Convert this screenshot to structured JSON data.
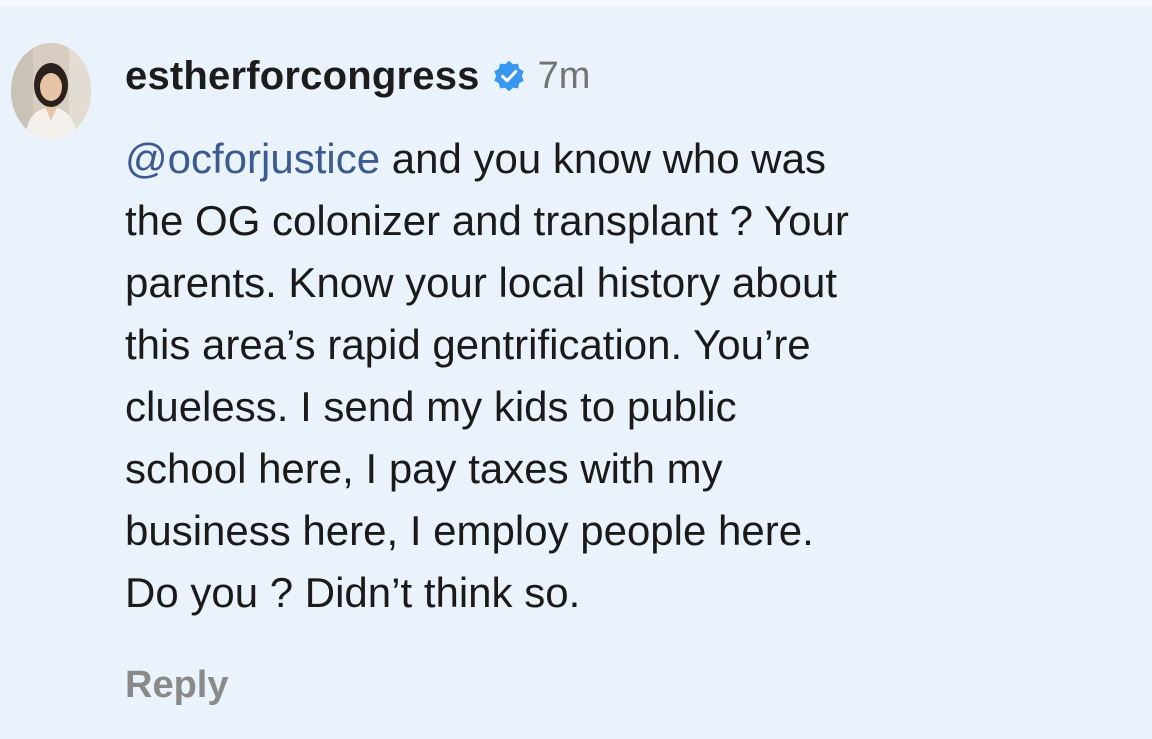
{
  "comment": {
    "username": "estherforcongress",
    "verified": true,
    "timestamp": "7m",
    "mention": "@ocforjustice",
    "lines": [
      " and you know who was",
      "the OG colonizer and transplant ? Your",
      "parents. Know your local history about",
      "this area’s rapid gentrification. You’re",
      "clueless. I send my kids to public",
      "school here, I pay taxes with my",
      "business here, I employ people here.",
      "Do you ? Didn’t think so."
    ],
    "reply_label": "Reply"
  },
  "icons": {
    "avatar": "profile-photo",
    "verified": "verified-badge-icon"
  },
  "colors": {
    "background": "#eaf2fb",
    "mention": "#3b5a8f",
    "verified_badge": "#3897f0",
    "muted_text": "#737373"
  }
}
